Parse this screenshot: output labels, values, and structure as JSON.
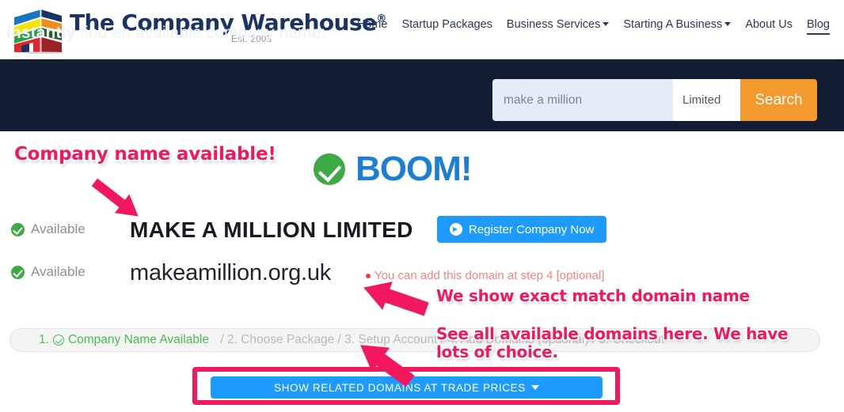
{
  "brand": {
    "name": "The Company Warehouse",
    "registered_mark": "®",
    "tagline": "Est. 2003",
    "logo_icon": "warehouse-building-icon",
    "logo_colors": [
      "#1b74bc",
      "#f5e400",
      "#2f9d4b",
      "#e3262b",
      "#1b3362",
      "#ef8c1e",
      "#2c5c2c",
      "#9e2024"
    ],
    "text_color": "#1b3362"
  },
  "nav": {
    "items": [
      {
        "label": "Home",
        "has_dropdown": false,
        "active": false
      },
      {
        "label": "Startup Packages",
        "has_dropdown": false,
        "active": false
      },
      {
        "label": "Business Services",
        "has_dropdown": true,
        "active": false
      },
      {
        "label": "Starting A Business",
        "has_dropdown": true,
        "active": false
      },
      {
        "label": "About Us",
        "has_dropdown": false,
        "active": false
      },
      {
        "label": "Blog",
        "has_dropdown": false,
        "active": true
      }
    ]
  },
  "search_band": {
    "background": "#121d31",
    "prompt_bold": "Instantly",
    "prompt_rest": " find an available company name:",
    "input_value": "make a million",
    "input_placeholder": "make a million",
    "suffix_label": "Limited",
    "button_label": "Search",
    "button_color": "#f29a2e"
  },
  "result": {
    "headline": "BOOM!",
    "headline_color": "#1d7fd1",
    "headline_icon": "check-circle-icon",
    "rows": [
      {
        "status": "Available",
        "value": "MAKE A MILLION LIMITED",
        "icon": "check-circle-icon"
      },
      {
        "status": "Available",
        "value": "makeamillion.org.uk",
        "icon": "check-circle-icon"
      }
    ],
    "register_button": {
      "label": "Register Company Now",
      "icon": "arrow-circle-right-icon",
      "color": "#1d9bff"
    },
    "domain_note": "You can add this domain at step 4 [optional]",
    "domain_note_color": "#f9837f"
  },
  "steps": {
    "current": "1. Company Name Available",
    "current_icon": "check-ring-icon",
    "current_number": "1.",
    "current_label": "Company Name Available",
    "remaining": "/ 2. Choose Package / 3. Setup Account / 4. Add Domains (optional) / 5. Checkout"
  },
  "cta": {
    "label": "SHOW RELATED DOMAINS AT TRADE PRICES",
    "caret_icon": "caret-down-icon",
    "color": "#1d9bff",
    "highlight_color": "#f2185f"
  },
  "annotations": {
    "color": "#f2185f",
    "a": "Company name available!",
    "b": "We show exact match domain name",
    "c": "See all available domains here. We have\nlots of choice.",
    "arrows": [
      {
        "name": "annotation-arrow-to-company-name",
        "direction": "down-right"
      },
      {
        "name": "annotation-arrow-to-domain",
        "direction": "left"
      },
      {
        "name": "annotation-arrow-to-cta",
        "direction": "down-left"
      }
    ]
  }
}
